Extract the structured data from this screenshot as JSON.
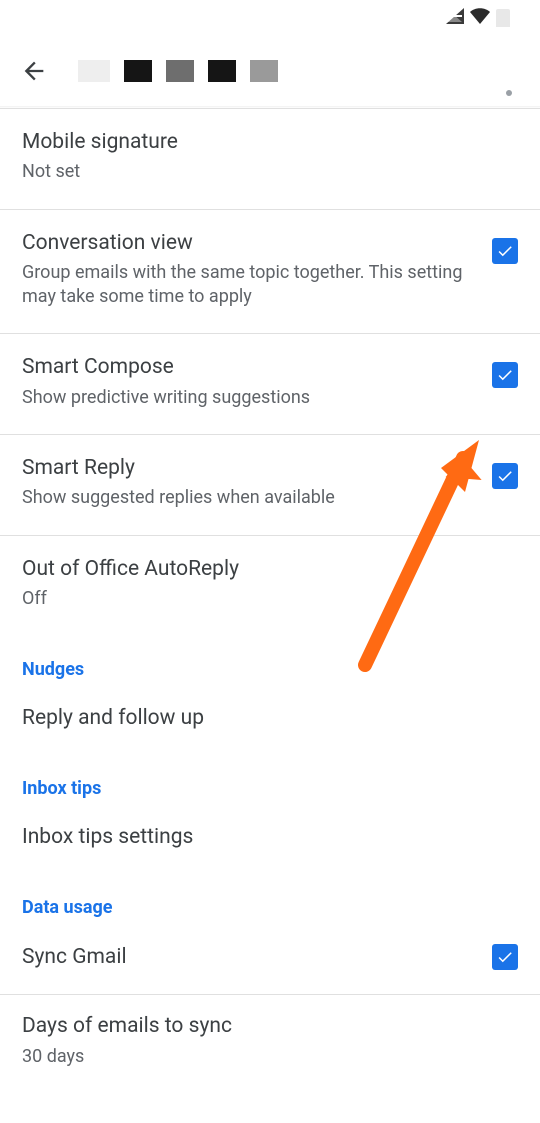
{
  "statusBar": {},
  "settings": {
    "mobileSignature": {
      "title": "Mobile signature",
      "sub": "Not set"
    },
    "conversationView": {
      "title": "Conversation view",
      "sub": "Group emails with the same topic together. This setting may take some time to apply",
      "checked": true
    },
    "smartCompose": {
      "title": "Smart Compose",
      "sub": "Show predictive writing suggestions",
      "checked": true
    },
    "smartReply": {
      "title": "Smart Reply",
      "sub": "Show suggested replies when available",
      "checked": true
    },
    "outOfOffice": {
      "title": "Out of Office AutoReply",
      "sub": "Off"
    }
  },
  "sections": {
    "nudges": {
      "header": "Nudges",
      "item": "Reply and follow up"
    },
    "inboxTips": {
      "header": "Inbox tips",
      "item": "Inbox tips settings"
    },
    "dataUsage": {
      "header": "Data usage",
      "syncGmail": {
        "title": "Sync Gmail",
        "checked": true
      },
      "daysToSync": {
        "title": "Days of emails to sync",
        "sub": "30 days"
      }
    }
  }
}
